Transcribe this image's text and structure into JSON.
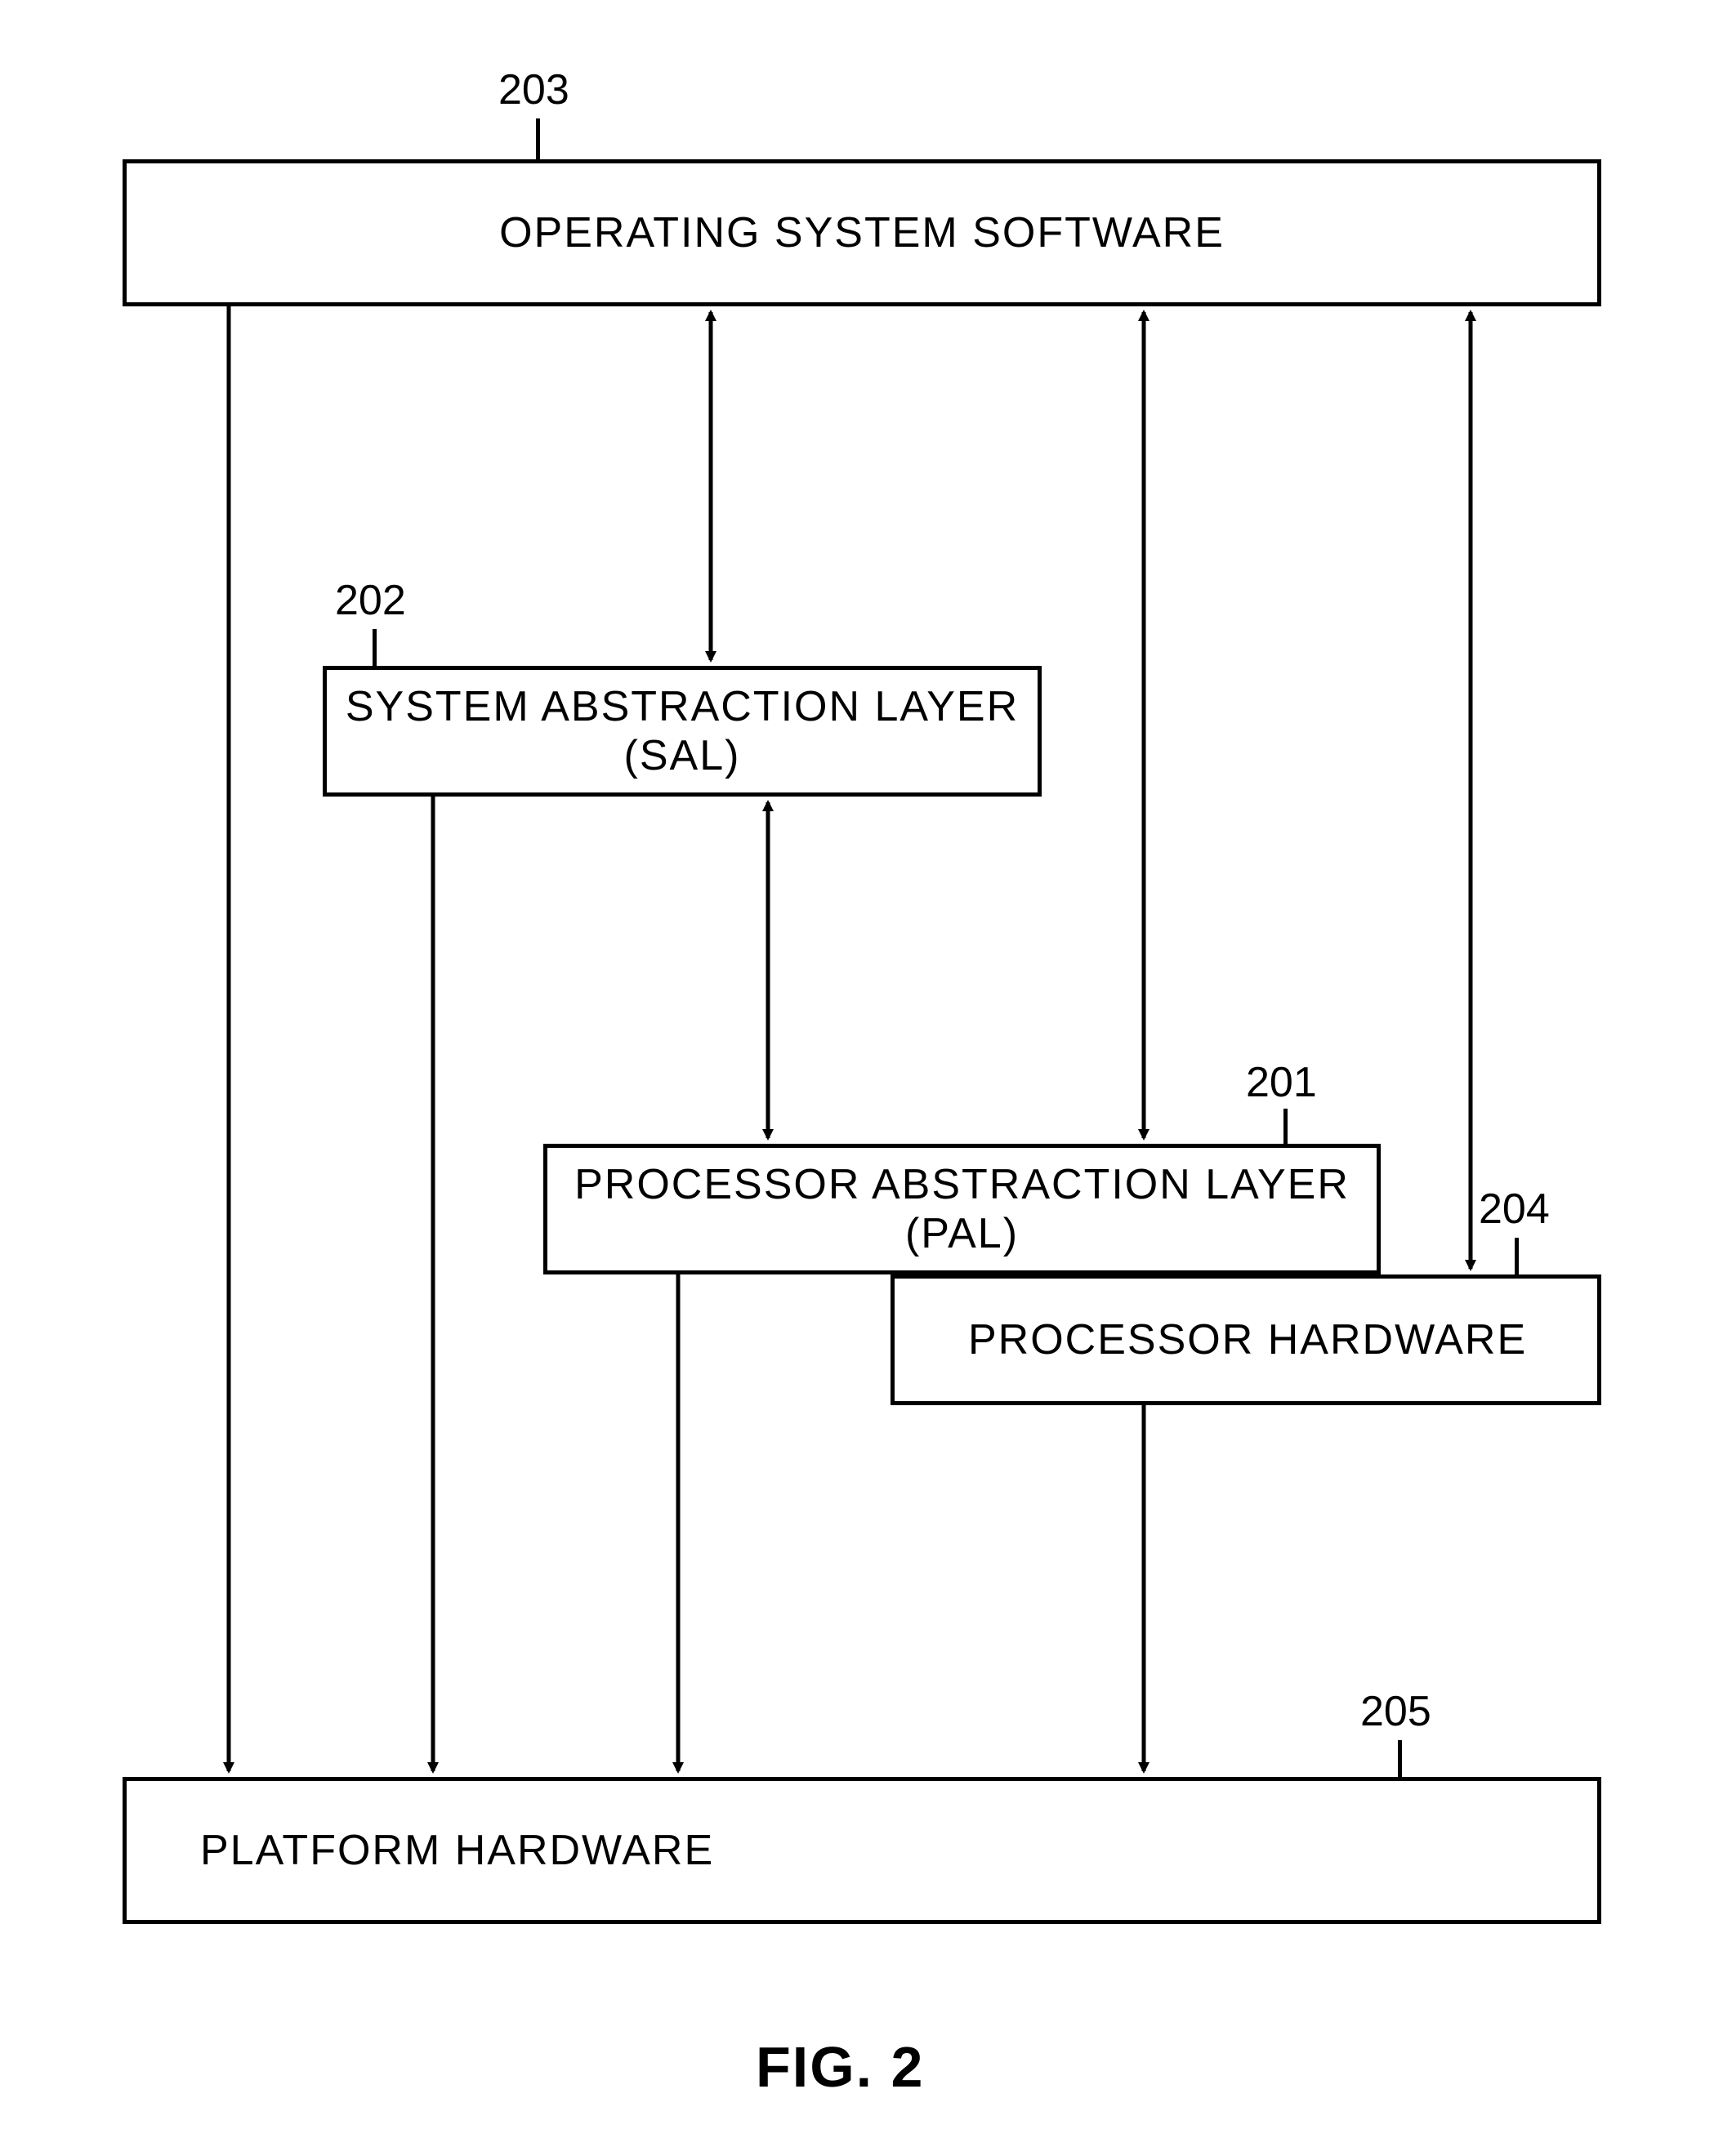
{
  "refs": {
    "r201": "201",
    "r202": "202",
    "r203": "203",
    "r204": "204",
    "r205": "205"
  },
  "boxes": {
    "os": "OPERATING SYSTEM SOFTWARE",
    "sal": "SYSTEM ABSTRACTION LAYER (SAL)",
    "pal": "PROCESSOR ABSTRACTION LAYER (PAL)",
    "proc": "PROCESSOR HARDWARE",
    "plat": "PLATFORM HARDWARE"
  },
  "figure": "FIG.  2"
}
